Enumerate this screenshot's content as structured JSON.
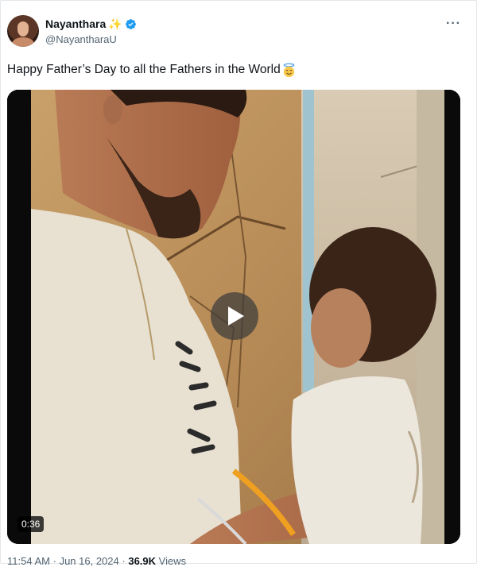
{
  "author": {
    "display_name": "Nayanthara",
    "badge_emoji": "✨",
    "handle": "@NayantharaU",
    "verified_icon": "verified-badge-icon",
    "verified_color": "#1d9bf0"
  },
  "tweet": {
    "text": "Happy Father’s Day to all the Fathers in the World",
    "emoji_icon": "smiling-face-with-halo-icon"
  },
  "media": {
    "type": "video",
    "duration": "0:36",
    "play_icon": "play-icon"
  },
  "meta": {
    "time": "11:54 AM",
    "separator": "·",
    "date": "Jun 16, 2024",
    "views_count": "36.9K",
    "views_label": "Views"
  },
  "colors": {
    "text_primary": "#0f1419",
    "text_secondary": "#536471",
    "sparkle": "#f5b90f"
  }
}
